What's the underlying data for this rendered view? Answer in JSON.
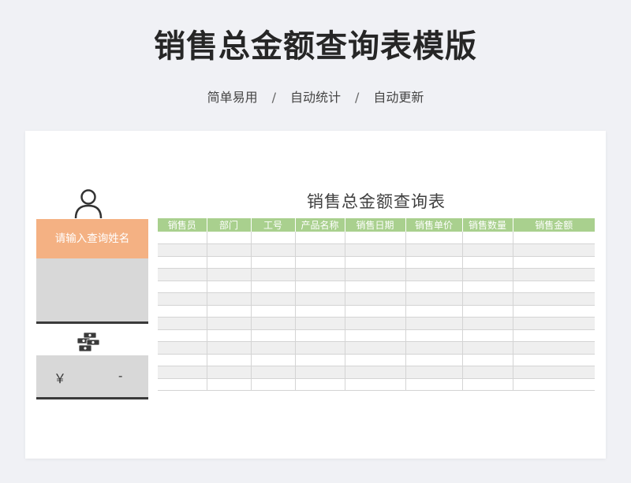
{
  "header": {
    "title": "销售总金额查询表模版",
    "features": [
      "简单易用",
      "自动统计",
      "自动更新"
    ],
    "separator": "/"
  },
  "panel": {
    "person_icon": "person-icon",
    "query_label": "请输入查询姓名",
    "query_value": "",
    "money_icon": "money-stack-icon",
    "currency_symbol": "￥",
    "total_amount": "-"
  },
  "table": {
    "title": "销售总金额查询表",
    "columns": [
      "销售员",
      "部门",
      "工号",
      "产品名称",
      "销售日期",
      "销售单价",
      "销售数量",
      "销售金额"
    ],
    "row_count": 13
  },
  "colors": {
    "header_green": "#a9d08e",
    "label_orange": "#f4b183",
    "input_gray": "#d8d8d8",
    "row_alt": "#efefef"
  }
}
